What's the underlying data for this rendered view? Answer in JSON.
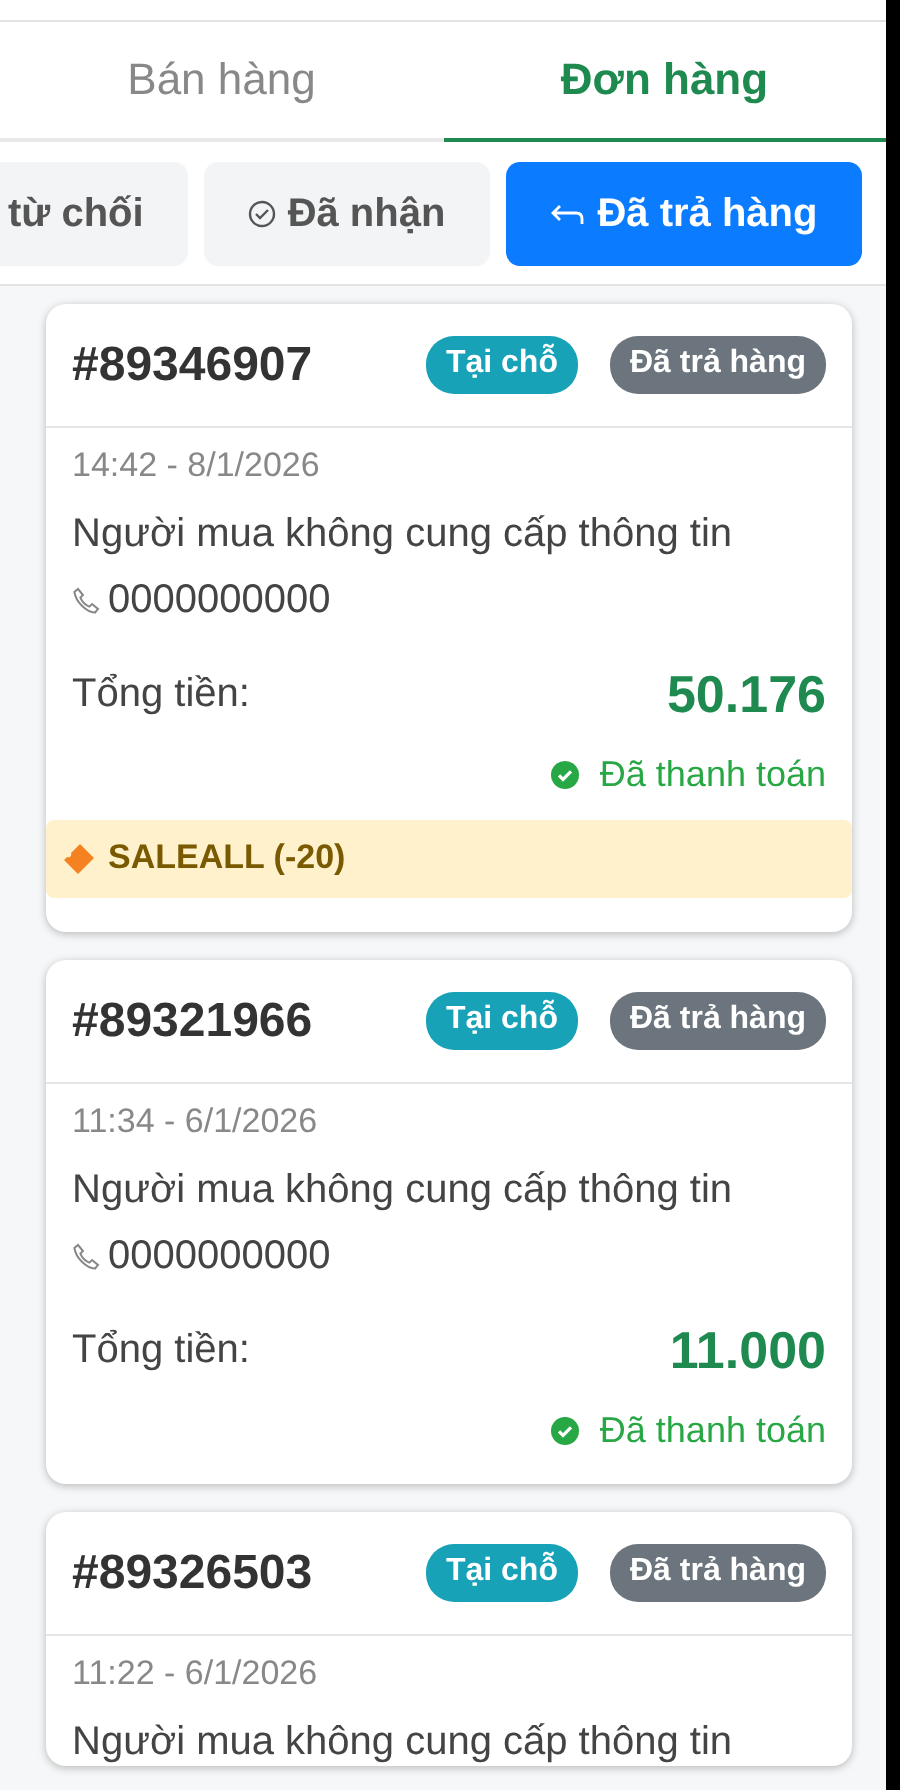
{
  "tabs": [
    {
      "label": "Bán hàng",
      "selected": false
    },
    {
      "label": "Đơn hàng",
      "selected": true
    }
  ],
  "filters": [
    {
      "label": "từ chối",
      "kind": "plain",
      "selected": false
    },
    {
      "label": "Đã nhận",
      "kind": "received",
      "selected": false
    },
    {
      "label": "Đã trả hàng",
      "kind": "returned",
      "selected": true
    }
  ],
  "orders": [
    {
      "id": "#89346907",
      "tags": [
        {
          "label": "Tại chỗ",
          "color": "#17a2b8"
        },
        {
          "label": "Đã trả hàng",
          "color": "#6c757d"
        }
      ],
      "time": "14:42 - 8/1/2026",
      "buyer": "Người mua không cung cấp thông tin",
      "phone": "0000000000",
      "total_label": "Tổng tiền:",
      "total": "50.176",
      "payment": "Đã thanh toán",
      "voucher": "SALEALL (-20)"
    },
    {
      "id": "#89321966",
      "tags": [
        {
          "label": "Tại chỗ",
          "color": "#17a2b8"
        },
        {
          "label": "Đã trả hàng",
          "color": "#6c757d"
        }
      ],
      "time": "11:34 - 6/1/2026",
      "buyer": "Người mua không cung cấp thông tin",
      "phone": "0000000000",
      "total_label": "Tổng tiền:",
      "total": "11.000",
      "payment": "Đã thanh toán"
    },
    {
      "id": "#89326503",
      "tags": [
        {
          "label": "Tại chỗ",
          "color": "#17a2b8"
        },
        {
          "label": "Đã trả hàng",
          "color": "#6c757d"
        }
      ],
      "time": "11:22 - 6/1/2026",
      "buyer": "Người mua không cung cấp thông tin"
    }
  ]
}
